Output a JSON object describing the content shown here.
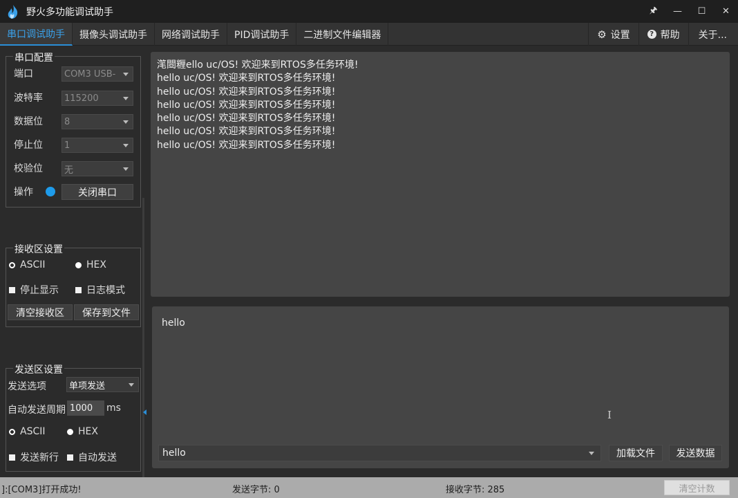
{
  "window": {
    "title": "野火多功能调试助手",
    "controls": [
      "🖈",
      "—",
      "☐",
      "✕"
    ]
  },
  "tabs": [
    {
      "label": "串口调试助手",
      "active": true
    },
    {
      "label": "摄像头调试助手"
    },
    {
      "label": "网络调试助手"
    },
    {
      "label": "PID调试助手"
    },
    {
      "label": "二进制文件编辑器"
    }
  ],
  "tabs_right": {
    "settings": "设置",
    "help": "帮助",
    "about": "关于..."
  },
  "serial_config": {
    "title": "串口配置",
    "port_label": "端口",
    "port_value": "COM3 USB-",
    "baud_label": "波特率",
    "baud_value": "115200",
    "databits_label": "数据位",
    "databits_value": "8",
    "stopbits_label": "停止位",
    "stopbits_value": "1",
    "parity_label": "校验位",
    "parity_value": "无",
    "operate_label": "操作",
    "close_button": "关闭串口"
  },
  "recv_settings": {
    "title": "接收区设置",
    "ascii": "ASCII",
    "hex": "HEX",
    "stop_display": "停止显示",
    "log_mode": "日志模式",
    "clear_button": "清空接收区",
    "save_button": "保存到文件"
  },
  "send_settings": {
    "title": "发送区设置",
    "option_label": "发送选项",
    "option_value": "单项发送",
    "period_label": "自动发送周期",
    "period_value": "1000",
    "period_unit": "ms",
    "ascii": "ASCII",
    "hex": "HEX",
    "newline": "发送新行",
    "auto_send": "自动发送"
  },
  "recv_lines": [
    "滗閸糎ello uc/OS!  欢迎来到RTOS多任务环境!",
    "hello uc/OS!  欢迎来到RTOS多任务环境!",
    "hello uc/OS!  欢迎来到RTOS多任务环境!",
    "hello uc/OS!  欢迎来到RTOS多任务环境!",
    "hello uc/OS!  欢迎来到RTOS多任务环境!",
    "hello uc/OS!  欢迎来到RTOS多任务环境!",
    "hello uc/OS!  欢迎来到RTOS多任务环境!"
  ],
  "send_area": {
    "text": "hello",
    "combo_value": "hello",
    "load_file_button": "加载文件",
    "send_button": "发送数据",
    "cursor_glyph": "I"
  },
  "status": {
    "message": "]:[COM3]打开成功!",
    "sent_bytes": "发送字节: 0",
    "recv_bytes": "接收字节: 285",
    "clear_count": "清空计数"
  },
  "colors": {
    "accent": "#2a8fd8",
    "status_dot": "#1e9bea"
  }
}
